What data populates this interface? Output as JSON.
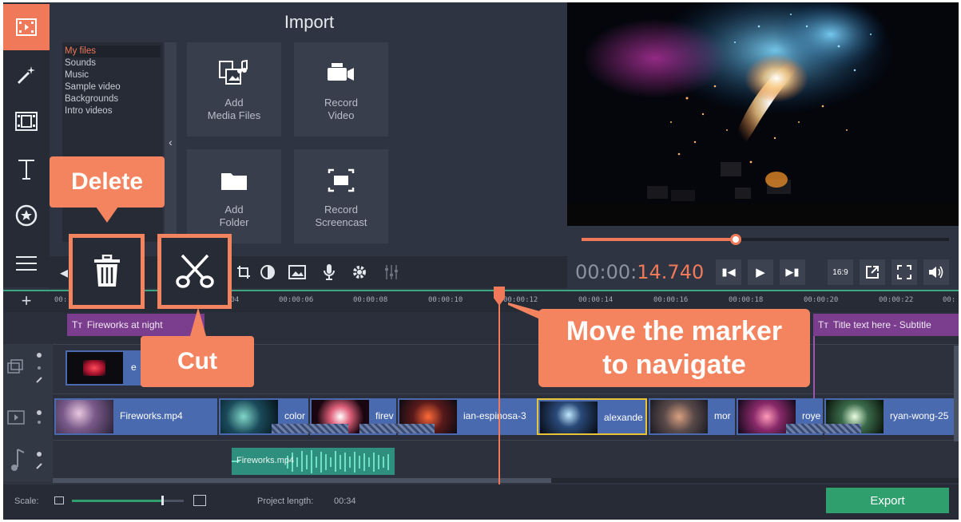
{
  "import": {
    "title": "Import",
    "categories": [
      "My files",
      "Sounds",
      "Music",
      "Sample video",
      "Backgrounds",
      "Intro videos"
    ],
    "tiles": [
      {
        "label": "Add\nMedia Files",
        "icon": "media-files-icon"
      },
      {
        "label": "Record\nVideo",
        "icon": "video-camera-icon"
      },
      {
        "label": "Add\nFolder",
        "icon": "folder-icon"
      },
      {
        "label": "Record\nScreencast",
        "icon": "screencast-icon"
      }
    ]
  },
  "preview": {
    "timecode_main": "00:00:",
    "timecode_frac": "14.740",
    "aspect": "16:9",
    "progress": 0.42
  },
  "ruler": {
    "ticks": [
      "00:",
      "00:00:04",
      "00:00:06",
      "00:00:08",
      "00:00:10",
      "00:00:12",
      "00:00:14",
      "00:00:16",
      "00:00:18",
      "00:00:20",
      "00:00:22",
      "00:"
    ]
  },
  "timeline": {
    "title_clips": [
      "Fireworks at night",
      "Title text here - Subtitle"
    ],
    "overlay_clip_label": "e",
    "video_clips": [
      "Fireworks.mp4",
      "color",
      "firev",
      "ian-espinosa-3",
      "alexande",
      "mor",
      "roye",
      "ryan-wong-25"
    ],
    "audio_clip": "Fireworks.mp4"
  },
  "bottom": {
    "scale_label": "Scale:",
    "scale_value": 0.8,
    "project_length_label": "Project length:",
    "project_length": "00:34",
    "export_label": "Export"
  },
  "callouts": {
    "delete": "Delete",
    "cut": "Cut",
    "marker": "Move the marker\nto navigate"
  },
  "colors": {
    "accent": "#f0795a",
    "callout": "#f4845f",
    "export": "#2fa06d",
    "title_clip": "#7b3d8e",
    "video_clip": "#4a6ab0",
    "audio_clip": "#2f8f7e"
  }
}
